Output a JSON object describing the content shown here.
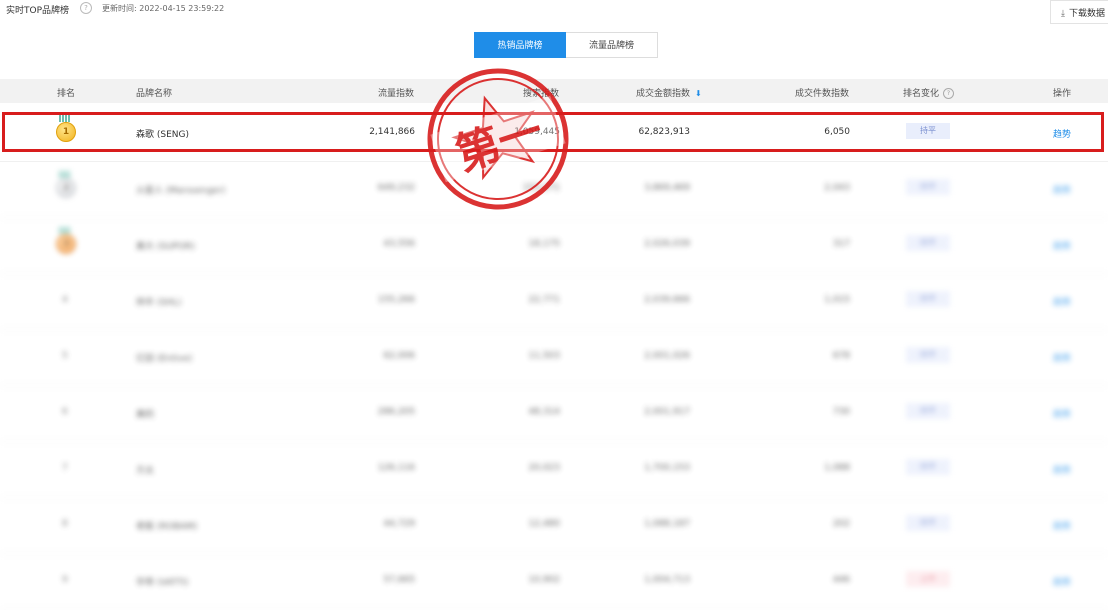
{
  "header": {
    "title": "实时TOP品牌榜",
    "help_icon": "question-circle-icon",
    "updated_label": "更新时间:",
    "updated_time": "2022-04-15 23:59:22",
    "download_label": "下载数据",
    "download_icon": "download-icon"
  },
  "tabs": [
    {
      "label": "热销品牌榜",
      "active": true
    },
    {
      "label": "流量品牌榜",
      "active": false
    }
  ],
  "table": {
    "columns": [
      "排名",
      "品牌名称",
      "流量指数",
      "搜索指数",
      "成交金额指数",
      "成交件数指数",
      "排名变化",
      "操作"
    ],
    "sort_icon": "sort-desc-icon",
    "rows": [
      {
        "rank": "1",
        "medal": "gold",
        "brand": "森歌 (SENG)",
        "traffic": "2,141,866",
        "search": "1,059,445",
        "gmv": "62,823,913",
        "orders": "6,050",
        "change": "持平",
        "action": "趋势"
      },
      {
        "rank": "2",
        "medal": "silver",
        "brand": "火星人 (Marssenger)",
        "traffic": "649,232",
        "search": "153,271",
        "gmv": "3,869,469",
        "orders": "2,043",
        "change": "持平",
        "action": "趋势"
      },
      {
        "rank": "3",
        "medal": "bronze",
        "brand": "美大 (SUPOR)",
        "traffic": "43,556",
        "search": "18,175",
        "gmv": "2,026,039",
        "orders": "317",
        "change": "持平",
        "action": "趋势"
      },
      {
        "rank": "4",
        "medal": "",
        "brand": "帅丰 (SHL)",
        "traffic": "155,266",
        "search": "22,771",
        "gmv": "2,039,666",
        "orders": "1,015",
        "change": "持平",
        "action": "趋势"
      },
      {
        "rank": "5",
        "medal": "",
        "brand": "亿田 (Entive)",
        "traffic": "62,006",
        "search": "11,503",
        "gmv": "2,001,026",
        "orders": "678",
        "change": "持平",
        "action": "趋势"
      },
      {
        "rank": "6",
        "medal": "",
        "brand": "美的",
        "traffic": "286,205",
        "search": "48,314",
        "gmv": "2,001,917",
        "orders": "730",
        "change": "持平",
        "action": "趋势"
      },
      {
        "rank": "7",
        "medal": "",
        "brand": "方太",
        "traffic": "126,116",
        "search": "20,023",
        "gmv": "1,700,153",
        "orders": "1,088",
        "change": "持平",
        "action": "趋势"
      },
      {
        "rank": "8",
        "medal": "",
        "brand": "老板 (ROBAM)",
        "traffic": "44,729",
        "search": "12,480",
        "gmv": "1,088,187",
        "orders": "202",
        "change": "持平",
        "action": "趋势"
      },
      {
        "rank": "9",
        "medal": "",
        "brand": "华帝 (VATTI)",
        "traffic": "57,665",
        "search": "10,902",
        "gmv": "1,004,713",
        "orders": "446",
        "change": "上升",
        "action": "趋势"
      }
    ]
  },
  "stamp": {
    "text": "第一",
    "color": "#d81d1d"
  },
  "colors": {
    "accent": "#1f8de8",
    "highlight": "#d81d1d"
  }
}
